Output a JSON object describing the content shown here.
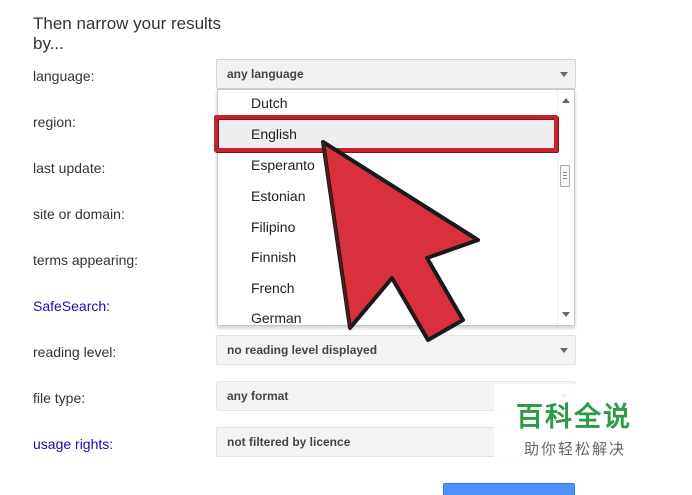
{
  "heading": "Then narrow your results by...",
  "rows": [
    {
      "label": "language:",
      "value": "any language"
    },
    {
      "label": "region:"
    },
    {
      "label": "last update:"
    },
    {
      "label": "site or domain:"
    },
    {
      "label": "terms appearing:"
    },
    {
      "label": "SafeSearch:"
    },
    {
      "label": "reading level:",
      "value": "no reading level displayed"
    },
    {
      "label": "file type:",
      "value": "any format"
    },
    {
      "label": "usage rights:",
      "value": "not filtered by licence"
    }
  ],
  "dropdown": {
    "options": [
      "Dutch",
      "English",
      "Esperanto",
      "Estonian",
      "Filipino",
      "Finnish",
      "French",
      "German"
    ],
    "highlighted": "English"
  },
  "annotation": {
    "color": "#c7222f",
    "arrow_color": "#d8303d"
  },
  "watermark": {
    "main": "百科全说",
    "sub": "助你轻松解决"
  },
  "colors": {
    "link": "#1a0dab",
    "watermark_green": "#2d9b45",
    "button_blue": "#4d90fe"
  }
}
